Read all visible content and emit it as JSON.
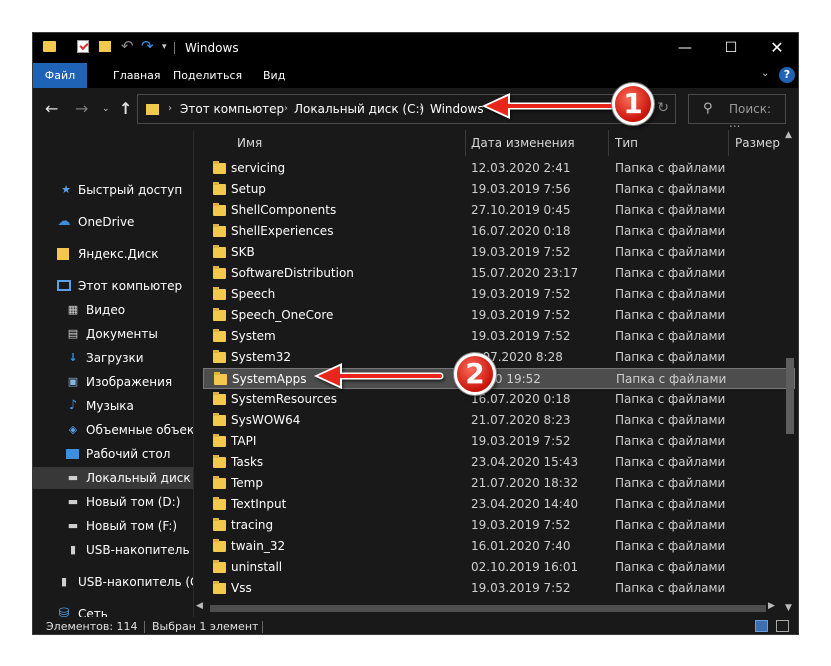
{
  "window": {
    "title": "Windows",
    "controls": {
      "minimize": "—",
      "maximize": "☐",
      "close": "✕"
    }
  },
  "ribbon": {
    "tabs": [
      "Файл",
      "Главная",
      "Поделиться",
      "Вид"
    ],
    "help": "?"
  },
  "address": {
    "crumbs": [
      "Этот компьютер",
      "Локальный диск (C:)",
      "Windows"
    ],
    "search_placeholder": "Поиск: ..."
  },
  "nav_pane": {
    "items": [
      {
        "label": "Быстрый доступ",
        "icon": "star-icon"
      },
      {
        "label": "OneDrive",
        "icon": "cloud-icon"
      },
      {
        "label": "Яндекс.Диск",
        "icon": "yandex-disk-icon"
      },
      {
        "label": "Этот компьютер",
        "icon": "computer-icon"
      },
      {
        "label": "Видео",
        "icon": "video-icon"
      },
      {
        "label": "Документы",
        "icon": "documents-icon"
      },
      {
        "label": "Загрузки",
        "icon": "downloads-icon"
      },
      {
        "label": "Изображения",
        "icon": "pictures-icon"
      },
      {
        "label": "Музыка",
        "icon": "music-icon"
      },
      {
        "label": "Объемные объект",
        "icon": "3d-objects-icon"
      },
      {
        "label": "Рабочий стол",
        "icon": "desktop-icon"
      },
      {
        "label": "Локальный диск (С",
        "icon": "drive-icon"
      },
      {
        "label": "Новый том (D:)",
        "icon": "drive-icon"
      },
      {
        "label": "Новый том (F:)",
        "icon": "drive-icon"
      },
      {
        "label": "USB-накопитель (G",
        "icon": "usb-icon"
      },
      {
        "label": "USB-накопитель (G:)",
        "icon": "usb-icon"
      },
      {
        "label": "Сеть",
        "icon": "network-icon"
      }
    ]
  },
  "file_list": {
    "columns": [
      "Имя",
      "Дата изменения",
      "Тип",
      "Размер"
    ],
    "rows": [
      {
        "name": "servicing",
        "date": "12.03.2020 2:41",
        "type": "Папка с файлами"
      },
      {
        "name": "Setup",
        "date": "19.03.2019 7:56",
        "type": "Папка с файлами"
      },
      {
        "name": "ShellComponents",
        "date": "27.10.2019 0:45",
        "type": "Папка с файлами"
      },
      {
        "name": "ShellExperiences",
        "date": "16.07.2020 0:18",
        "type": "Папка с файлами"
      },
      {
        "name": "SKB",
        "date": "19.03.2019 7:52",
        "type": "Папка с файлами"
      },
      {
        "name": "SoftwareDistribution",
        "date": "15.07.2020 23:17",
        "type": "Папка с файлами"
      },
      {
        "name": "Speech",
        "date": "19.03.2019 7:52",
        "type": "Папка с файлами"
      },
      {
        "name": "Speech_OneCore",
        "date": "19.03.2019 7:52",
        "type": "Папка с файлами"
      },
      {
        "name": "System",
        "date": "19.03.2019 7:52",
        "type": "Папка с файлами"
      },
      {
        "name": "System32",
        "date": "1.07.2020 8:28",
        "type": "Папка с файлами"
      },
      {
        "name": "SystemApps",
        "date": "2020 19:52",
        "type": "Папка с файлами",
        "selected": true
      },
      {
        "name": "SystemResources",
        "date": "16.07.2020 0:18",
        "type": "Папка с файлами"
      },
      {
        "name": "SysWOW64",
        "date": "21.07.2020 8:23",
        "type": "Папка с файлами"
      },
      {
        "name": "TAPI",
        "date": "19.03.2019 7:52",
        "type": "Папка с файлами"
      },
      {
        "name": "Tasks",
        "date": "23.04.2020 15:43",
        "type": "Папка с файлами"
      },
      {
        "name": "Temp",
        "date": "21.07.2020 18:32",
        "type": "Папка с файлами"
      },
      {
        "name": "TextInput",
        "date": "23.04.2020 14:40",
        "type": "Папка с файлами"
      },
      {
        "name": "tracing",
        "date": "19.03.2019 7:52",
        "type": "Папка с файлами"
      },
      {
        "name": "twain_32",
        "date": "16.01.2020 7:40",
        "type": "Папка с файлами"
      },
      {
        "name": "uninstall",
        "date": "02.10.2019 16:01",
        "type": "Папка с файлами"
      },
      {
        "name": "Vss",
        "date": "19.03.2019 7:52",
        "type": "Папка с файлами"
      }
    ]
  },
  "status": {
    "count": "Элементов: 114",
    "selection": "Выбран 1 элемент"
  },
  "annotations": {
    "badge1": "1",
    "badge2": "2",
    "arrow_color": "#e8261a"
  }
}
